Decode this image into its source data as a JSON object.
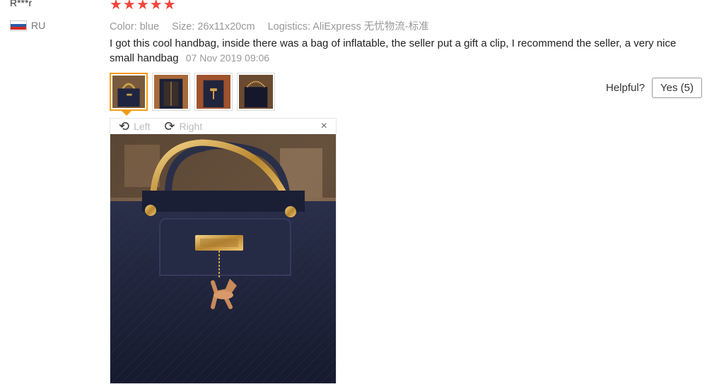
{
  "reviewer": {
    "name": "R***r",
    "country_code": "RU",
    "flag_colors": [
      "#ffffff",
      "#2d5aa8",
      "#d52b1e"
    ]
  },
  "rating": {
    "stars": 5,
    "glyphs": "★★★★★",
    "star_color": "#f0463c"
  },
  "meta": {
    "color": "Color: blue",
    "size": "Size: 26x11x20cm",
    "logistics": "Logistics: AliExpress 无忧物流-标准"
  },
  "review": {
    "text": "I got this cool handbag, inside there was a bag of inflatable, the seller put a gift a clip, I recommend the seller, a very nice small handbag",
    "date": "07 Nov 2019 09:06"
  },
  "thumbnails": [
    {
      "label": "handbag-front-thumb",
      "active": true
    },
    {
      "label": "handbag-inside-thumb",
      "active": false
    },
    {
      "label": "handbag-clasp-thumb",
      "active": false
    },
    {
      "label": "handbag-chain-thumb",
      "active": false
    }
  ],
  "viewer": {
    "rotate_left_label": "Left",
    "rotate_right_label": "Right",
    "close_glyph": "×",
    "rotate_left_glyph": "⟲",
    "rotate_right_glyph": "⟳"
  },
  "helpful": {
    "label": "Helpful?",
    "yes_button": "Yes (5)"
  },
  "accent_color": "#f39c12"
}
